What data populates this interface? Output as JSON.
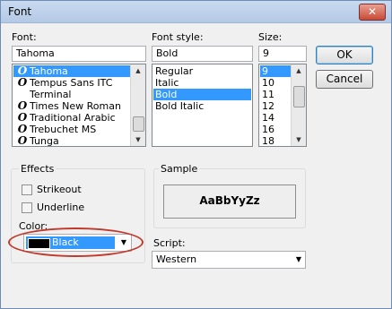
{
  "window": {
    "title": "Font",
    "close_glyph": "✕"
  },
  "font": {
    "label": "Font:",
    "value": "Tahoma",
    "items": [
      {
        "name": "Tahoma",
        "icon": "O",
        "selected": true
      },
      {
        "name": "Tempus Sans ITC",
        "icon": "O",
        "selected": false
      },
      {
        "name": "Terminal",
        "icon": "",
        "selected": false
      },
      {
        "name": "Times New Roman",
        "icon": "O",
        "selected": false
      },
      {
        "name": "Traditional Arabic",
        "icon": "O",
        "selected": false
      },
      {
        "name": "Trebuchet MS",
        "icon": "O",
        "selected": false
      },
      {
        "name": "Tunga",
        "icon": "O",
        "selected": false
      }
    ]
  },
  "style": {
    "label": "Font style:",
    "value": "Bold",
    "items": [
      {
        "name": "Regular",
        "selected": false
      },
      {
        "name": "Italic",
        "selected": false
      },
      {
        "name": "Bold",
        "selected": true
      },
      {
        "name": "Bold Italic",
        "selected": false
      }
    ]
  },
  "size": {
    "label": "Size:",
    "value": "9",
    "items": [
      {
        "name": "9",
        "selected": true
      },
      {
        "name": "10",
        "selected": false
      },
      {
        "name": "11",
        "selected": false
      },
      {
        "name": "12",
        "selected": false
      },
      {
        "name": "14",
        "selected": false
      },
      {
        "name": "16",
        "selected": false
      },
      {
        "name": "18",
        "selected": false
      }
    ]
  },
  "buttons": {
    "ok": "OK",
    "cancel": "Cancel"
  },
  "effects": {
    "label": "Effects",
    "strikeout": "Strikeout",
    "underline": "Underline",
    "color_label": "Color:",
    "color_value": "Black"
  },
  "sample": {
    "label": "Sample",
    "text": "AaBbYyZz"
  },
  "script": {
    "label": "Script:",
    "value": "Western"
  },
  "colors": {
    "highlight": "#3399ff",
    "annotation": "#c0392b"
  }
}
